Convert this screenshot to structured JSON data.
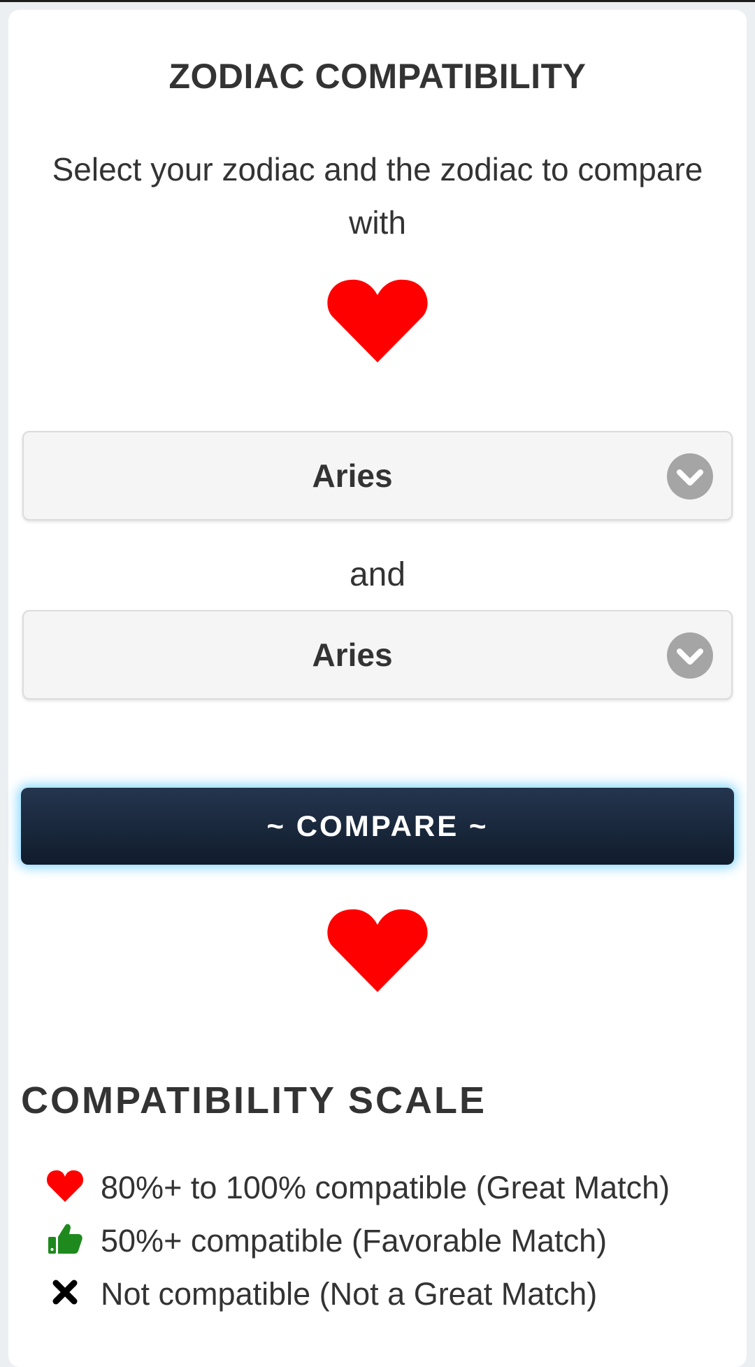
{
  "header": {
    "title": "ZODIAC COMPATIBILITY",
    "subtitle": "Select your zodiac and the zodiac to compare with"
  },
  "selectors": {
    "first_value": "Aries",
    "connector": "and",
    "second_value": "Aries"
  },
  "compare_button": {
    "label": "~ COMPARE ~"
  },
  "scale": {
    "title": "COMPATIBILITY SCALE",
    "items": [
      {
        "icon": "heart-icon",
        "text": "80%+ to 100% compatible (Great Match)"
      },
      {
        "icon": "thumbs-up-icon",
        "text": "50%+ compatible (Favorable Match)"
      },
      {
        "icon": "x-icon",
        "text": "Not compatible (Not a Great Match)"
      }
    ]
  },
  "colors": {
    "heart": "#ff0000",
    "thumbs_up": "#1e8a1e",
    "button_bg": "#1a2a40",
    "button_glow": "#5ac8ff"
  }
}
